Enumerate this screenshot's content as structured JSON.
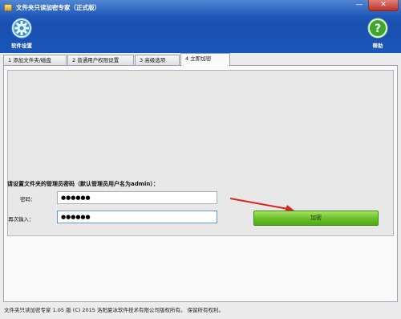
{
  "window": {
    "title": "文件夹只读加密专家（正式版）",
    "min_symbol": "—",
    "close_symbol": "✕"
  },
  "toolbar": {
    "settings_label": "软件设置",
    "settings_icon": "gear-icon",
    "help_label": "帮助",
    "help_icon": "question-mark-icon"
  },
  "tabs": [
    {
      "label": "1 添加文件夹/磁盘",
      "active": false
    },
    {
      "label": "2 普通用户权限设置",
      "active": false
    },
    {
      "label": "3 高级选项",
      "active": false
    },
    {
      "label": "4 立即加密",
      "active": true
    }
  ],
  "form": {
    "prompt": "请设置文件夹的管理员密码（默认管理员用户名为admin）：",
    "password_label": "密码：",
    "password_value": "●●●●●●",
    "confirm_label": "再次输入：",
    "confirm_value": "●●●●●●",
    "encrypt_label": "加密"
  },
  "footer": {
    "text": "文件夹只读加密专家 1.05 版 (C) 2015 洛阳夏冰软件技术有限公司版权所有。 保留所有权利。"
  },
  "colors": {
    "header_blue": "#1a56b8",
    "button_green": "#6cc22c",
    "arrow_red": "#d9261c"
  }
}
